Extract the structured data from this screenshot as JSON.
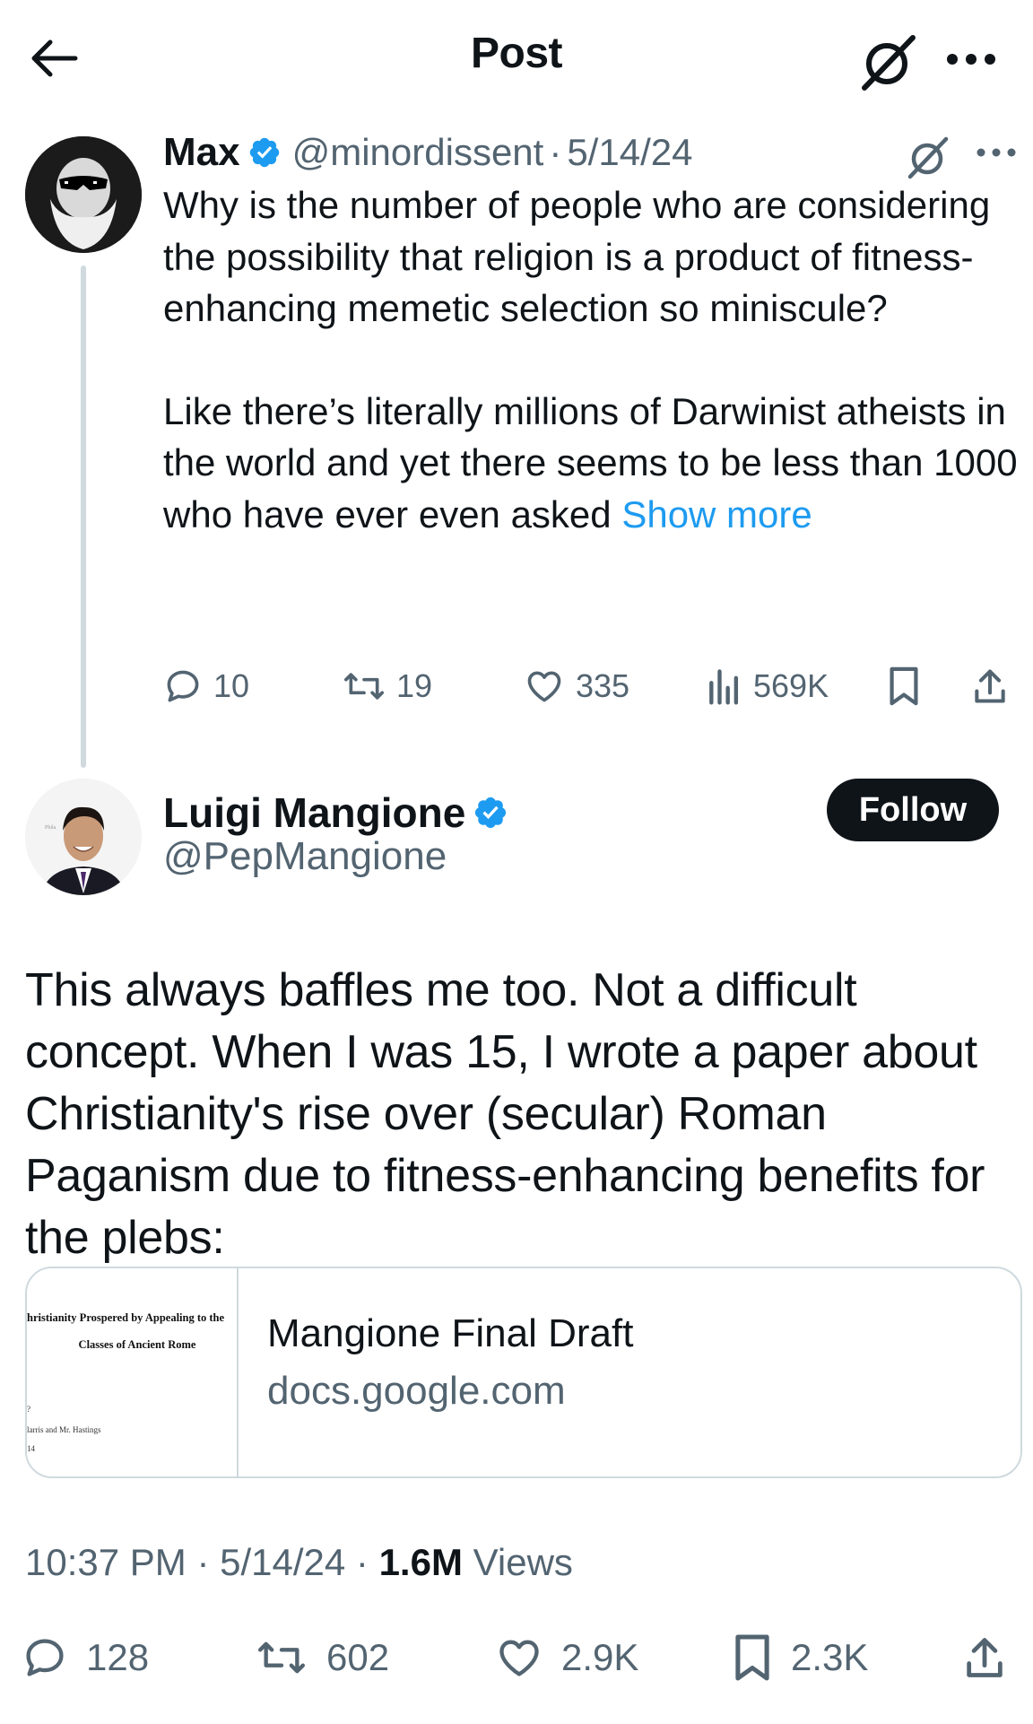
{
  "header": {
    "title": "Post"
  },
  "quoted": {
    "name": "Max",
    "handle": "@minordissent",
    "sep": "·",
    "date": "5/14/24",
    "para1": "Why is the number of people who are considering the possibility that religion is a product of fitness-enhancing memetic selection so miniscule?",
    "para2": "Like there’s literally millions of Darwinist atheists in the world and yet there seems to be less than 1000 who have ever even asked",
    "show_more": "Show more",
    "replies": "10",
    "reposts": "19",
    "likes": "335",
    "views": "569K"
  },
  "tweet": {
    "name": "Luigi Mangione",
    "handle": "@PepMangione",
    "follow_label": "Follow",
    "text": "This always baffles me too. Not a difficult concept. When I was 15, I wrote a paper about Christianity's rise over (secular) Roman Paganism due to fitness-enhancing benefits for the plebs:",
    "card": {
      "title": "Mangione Final Draft",
      "domain": "docs.google.com",
      "thumb_line1": "hristianity Prospered by Appealing to the",
      "thumb_line2": "Classes of Ancient Rome",
      "thumb_line3": "?",
      "thumb_line4": "larris and Mr. Hastings",
      "thumb_line5": "14"
    },
    "time": "10:37 PM",
    "date": "5/14/24",
    "views_count": "1.6M",
    "views_label": "Views",
    "replies": "128",
    "reposts": "602",
    "likes": "2.9K",
    "bookmarks": "2.3K"
  },
  "colors": {
    "accent": "#1d9bf0",
    "text": "#0f1419",
    "secondary": "#536471",
    "border": "#cfd9de"
  },
  "icons": [
    "back-arrow-icon",
    "grok-icon",
    "more-icon",
    "verified-badge-icon",
    "reply-icon",
    "repost-icon",
    "like-icon",
    "views-icon",
    "bookmark-icon",
    "share-icon"
  ]
}
